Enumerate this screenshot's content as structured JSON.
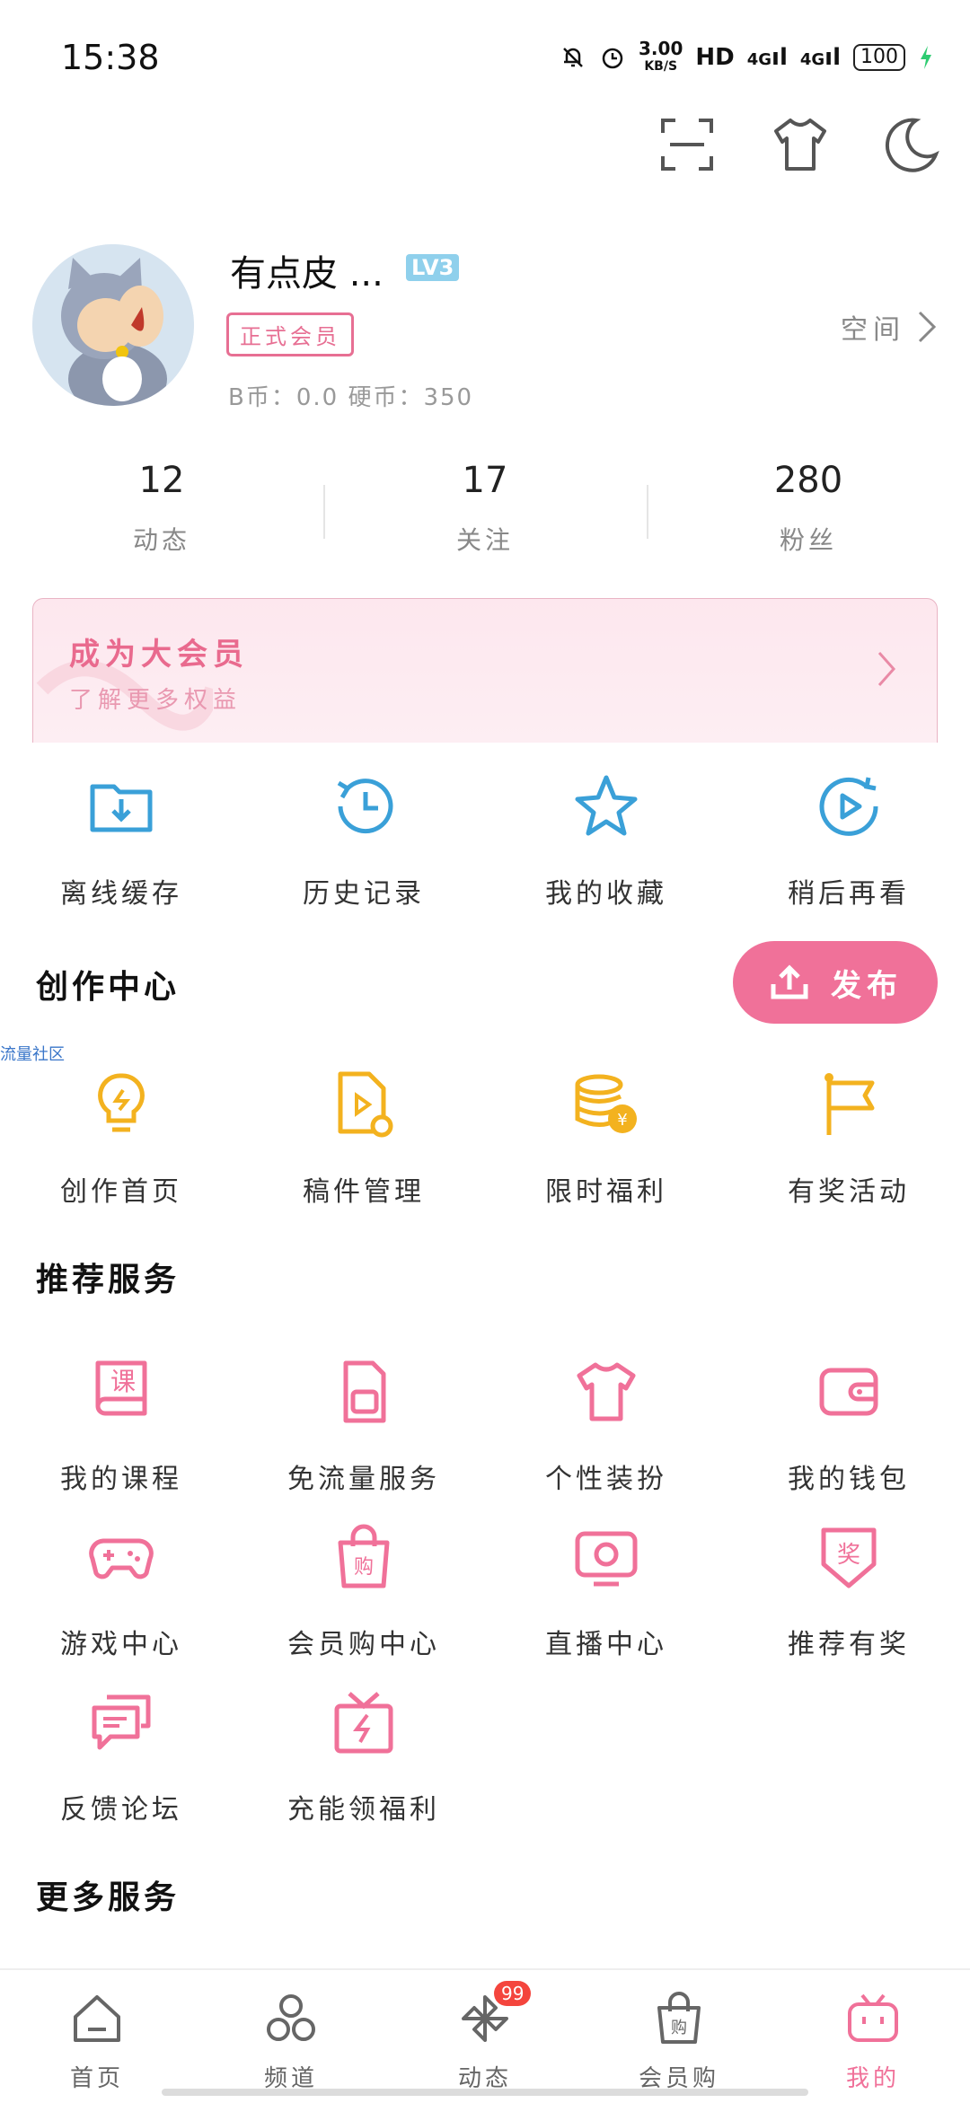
{
  "status_bar": {
    "time": "15:38",
    "speed_value": "3.00",
    "speed_unit": "KB/S",
    "hd": "HD",
    "net1": "4G",
    "net2": "4G",
    "battery": "100"
  },
  "profile": {
    "username": "有点皮 ...",
    "level": "LV3",
    "vip_badge": "正式会员",
    "coins": "B币：0.0   硬币：350",
    "space_label": "空间"
  },
  "stats": [
    {
      "value": "12",
      "label": "动态"
    },
    {
      "value": "17",
      "label": "关注"
    },
    {
      "value": "280",
      "label": "粉丝"
    }
  ],
  "vip_banner": {
    "title": "成为大会员",
    "subtitle": "了解更多权益"
  },
  "quick_actions": [
    {
      "label": "离线缓存",
      "icon": "download-folder-icon"
    },
    {
      "label": "历史记录",
      "icon": "history-clock-icon"
    },
    {
      "label": "我的收藏",
      "icon": "star-icon"
    },
    {
      "label": "稍后再看",
      "icon": "watch-later-icon"
    }
  ],
  "creator": {
    "title": "创作中心",
    "publish_label": "发布",
    "community_tag": "流量社区",
    "items": [
      {
        "label": "创作首页",
        "icon": "lightbulb-icon"
      },
      {
        "label": "稿件管理",
        "icon": "manuscript-icon"
      },
      {
        "label": "限时福利",
        "icon": "coins-icon"
      },
      {
        "label": "有奖活动",
        "icon": "flag-icon"
      }
    ]
  },
  "recommended": {
    "title": "推荐服务",
    "items": [
      {
        "label": "我的课程",
        "icon": "course-icon"
      },
      {
        "label": "免流量服务",
        "icon": "sim-card-icon"
      },
      {
        "label": "个性装扮",
        "icon": "tshirt-icon"
      },
      {
        "label": "我的钱包",
        "icon": "wallet-icon"
      },
      {
        "label": "游戏中心",
        "icon": "gamepad-icon"
      },
      {
        "label": "会员购中心",
        "icon": "shopping-bag-icon"
      },
      {
        "label": "直播中心",
        "icon": "live-tv-icon"
      },
      {
        "label": "推荐有奖",
        "icon": "reward-badge-icon"
      },
      {
        "label": "反馈论坛",
        "icon": "feedback-chat-icon"
      },
      {
        "label": "充能领福利",
        "icon": "gift-charge-icon"
      }
    ]
  },
  "more_services": {
    "title": "更多服务"
  },
  "bottom_nav": [
    {
      "label": "首页",
      "icon": "home-icon"
    },
    {
      "label": "频道",
      "icon": "channel-icon"
    },
    {
      "label": "动态",
      "icon": "pinwheel-icon",
      "badge": "99"
    },
    {
      "label": "会员购",
      "icon": "shop-bag-icon"
    },
    {
      "label": "我的",
      "icon": "tv-mascot-icon",
      "active": true
    }
  ],
  "colors": {
    "pink": "#f07199",
    "blue": "#3aa0d8",
    "yellow": "#f3b21f"
  }
}
